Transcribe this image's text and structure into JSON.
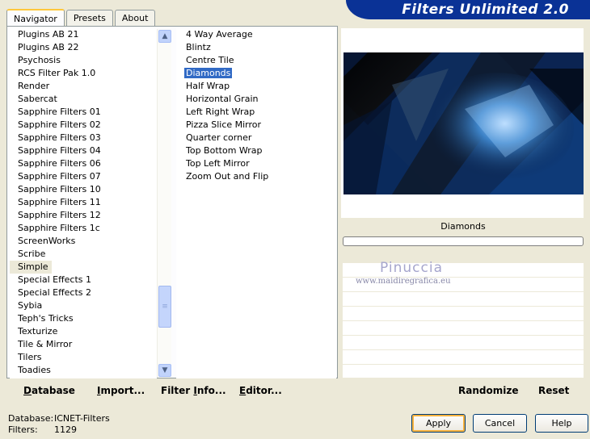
{
  "header": {
    "title": "Filters Unlimited 2.0"
  },
  "tabs": [
    {
      "label": "Navigator",
      "active": true
    },
    {
      "label": "Presets",
      "active": false
    },
    {
      "label": "About",
      "active": false
    }
  ],
  "categories": {
    "items": [
      "Plugins AB 21",
      "Plugins AB 22",
      "Psychosis",
      "RCS Filter Pak 1.0",
      "Render",
      "Sabercat",
      "Sapphire Filters 01",
      "Sapphire Filters 02",
      "Sapphire Filters 03",
      "Sapphire Filters 04",
      "Sapphire Filters 06",
      "Sapphire Filters 07",
      "Sapphire Filters 10",
      "Sapphire Filters 11",
      "Sapphire Filters 12",
      "Sapphire Filters 1c",
      "ScreenWorks",
      "Scribe",
      "Simple",
      "Special Effects 1",
      "Special Effects 2",
      "Sybia",
      "Teph's Tricks",
      "Texturize",
      "Tile & Mirror",
      "Tilers",
      "Toadies"
    ],
    "selected": "Simple"
  },
  "filters": {
    "items": [
      "4 Way Average",
      "Blintz",
      "Centre Tile",
      "Diamonds",
      "Half Wrap",
      "Horizontal Grain",
      "Left Right Wrap",
      "Pizza Slice Mirror",
      "Quarter corner",
      "Top Bottom Wrap",
      "Top Left Mirror",
      "Zoom Out and Flip"
    ],
    "selected": "Diamonds"
  },
  "preview": {
    "filter_name": "Diamonds"
  },
  "watermark": {
    "name": "Pinuccia",
    "url": "www.maidiregrafica.eu"
  },
  "toolbar": {
    "database": {
      "first": "D",
      "rest": "atabase"
    },
    "import": {
      "first": "I",
      "rest": "mport..."
    },
    "filter_info": {
      "pre": "Filter ",
      "first": "I",
      "rest": "nfo..."
    },
    "editor": {
      "first": "E",
      "rest": "ditor..."
    },
    "randomize": "Randomize",
    "reset": "Reset"
  },
  "status": {
    "database_label": "Database:",
    "database_value": "ICNET-Filters",
    "filters_label": "Filters:",
    "filters_value": "1129"
  },
  "buttons": {
    "apply": "Apply",
    "cancel": "Cancel",
    "help": "Help"
  },
  "colors": {
    "banner": "#0a3296",
    "selection": "#316ac5",
    "window": "#ece9d8"
  }
}
